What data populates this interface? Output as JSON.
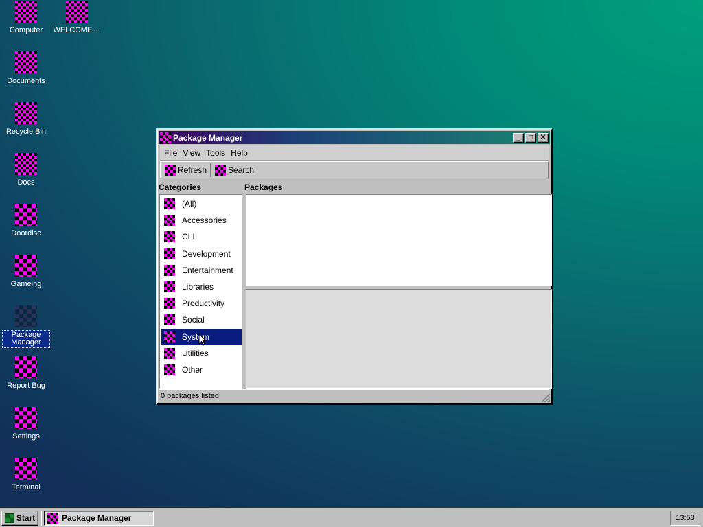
{
  "desktop": {
    "icons": [
      {
        "label": "Computer"
      },
      {
        "label": "WELCOME...."
      },
      {
        "label": "Documents"
      },
      {
        "label": "Recycle Bin"
      },
      {
        "label": "Docs"
      },
      {
        "label": "Doordisc"
      },
      {
        "label": "Gameing"
      },
      {
        "label": "Package\nManager"
      },
      {
        "label": "Report Bug"
      },
      {
        "label": "Settings"
      },
      {
        "label": "Terminal"
      }
    ]
  },
  "window": {
    "title": "Package Manager",
    "controls": {
      "minimize": "_",
      "maximize": "□",
      "close": "✕"
    },
    "menu": [
      "File",
      "View",
      "Tools",
      "Help"
    ],
    "toolbar": {
      "refresh": "Refresh",
      "search": "Search"
    },
    "categories_label": "Categories",
    "packages_label": "Packages",
    "categories": [
      "(All)",
      "Accessories",
      "CLI",
      "Development",
      "Entertainment",
      "Libraries",
      "Productivity",
      "Social",
      "System",
      "Utilities",
      "Other"
    ],
    "selected_category": "System",
    "status": "0 packages listed"
  },
  "taskbar": {
    "start": "Start",
    "task": "Package Manager",
    "clock": "13:53"
  },
  "colors": {
    "selection": "#0a1b7e",
    "icon_pink": "#ff00ff",
    "title_gradient_start": "#3f0062",
    "title_gradient_end": "#18866f"
  }
}
